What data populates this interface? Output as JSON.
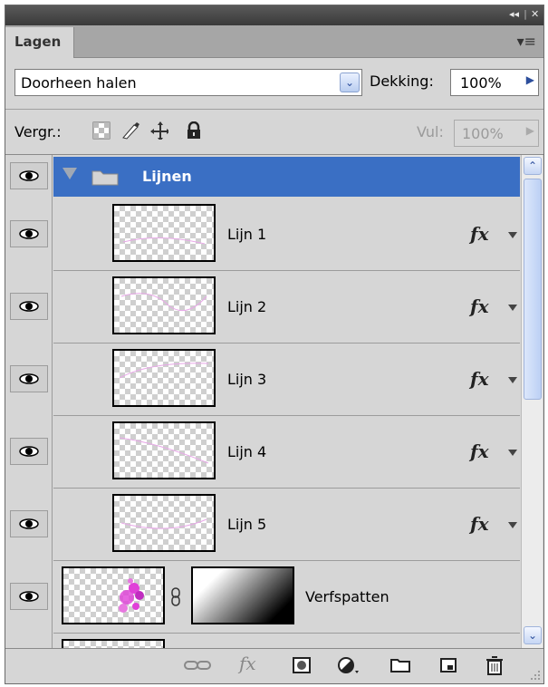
{
  "window": {
    "collapse_icon": "double-chevron-left-icon",
    "close_icon": "close-icon"
  },
  "panel": {
    "tab_label": "Lagen",
    "menu_icon": "panel-menu-icon"
  },
  "blend": {
    "mode_value": "Doorheen halen",
    "opacity_label": "Dekking:",
    "opacity_value": "100%"
  },
  "lock": {
    "label": "Vergr.:",
    "icons": [
      "lock-transparent-pixels-icon",
      "lock-image-pixels-icon",
      "lock-position-icon",
      "lock-all-icon"
    ],
    "fill_label": "Vul:",
    "fill_value": "100%"
  },
  "layers": {
    "group": {
      "name": "Lijnen",
      "expanded": true,
      "visible": true
    },
    "items": [
      {
        "name": "Lijn 1",
        "visible": true,
        "has_fx": true
      },
      {
        "name": "Lijn 2",
        "visible": true,
        "has_fx": true
      },
      {
        "name": "Lijn 3",
        "visible": true,
        "has_fx": true
      },
      {
        "name": "Lijn 4",
        "visible": true,
        "has_fx": true
      },
      {
        "name": "Lijn 5",
        "visible": true,
        "has_fx": true
      },
      {
        "name": "Verfspatten",
        "visible": true,
        "has_fx": false,
        "has_mask": true
      }
    ],
    "fx_label": "fx"
  },
  "footer": {
    "icons": [
      "link-layers-icon",
      "layer-style-icon",
      "layer-mask-icon",
      "adjustment-layer-icon",
      "new-group-icon",
      "new-layer-icon",
      "delete-layer-icon"
    ],
    "fx_label": "fx"
  },
  "colors": {
    "selection": "#3a6fc4",
    "panel_bg": "#d6d6d6",
    "paint_magenta": "#e040d8"
  }
}
